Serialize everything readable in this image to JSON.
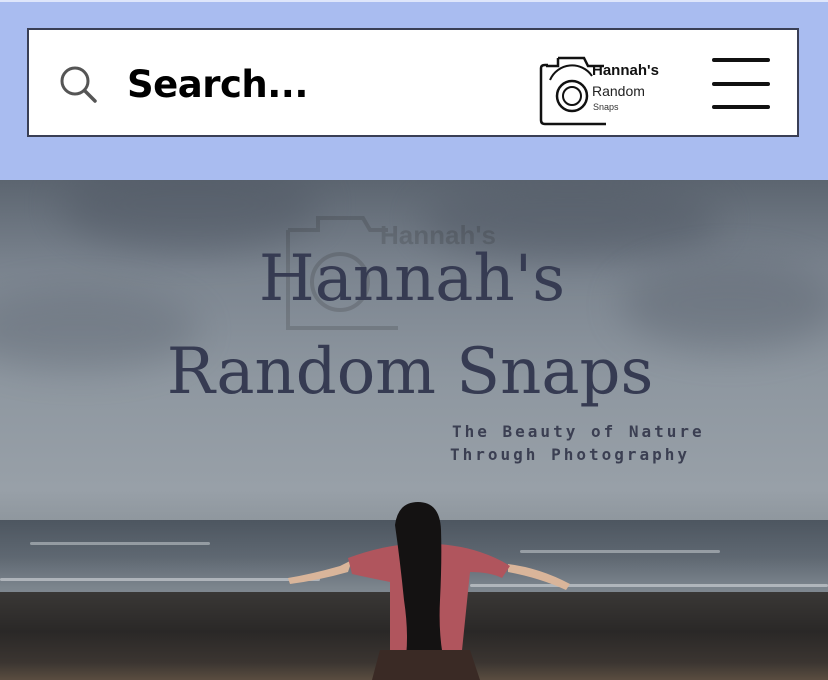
{
  "header": {
    "search_label": "Search...",
    "logo": {
      "line1": "Hannah's",
      "line2": "Random",
      "line3": "Snaps"
    },
    "menu_icon": "hamburger-menu-icon",
    "search_icon": "search-icon"
  },
  "hero": {
    "title_line1": "Hannah's",
    "title_line2": "Random Snaps",
    "tagline_line1": "The Beauty of Nature",
    "tagline_line2": "Through Photography",
    "watermark_line1": "Hannah's"
  },
  "colors": {
    "top_background": "#a9bcf0",
    "header_border": "#3a3f55",
    "title_color": "#363b52"
  }
}
